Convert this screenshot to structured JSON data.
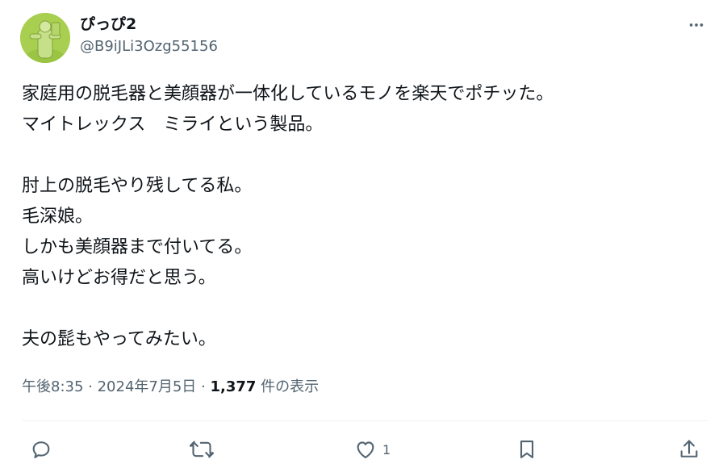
{
  "user": {
    "display_name": "ぴっぴ2",
    "handle": "@B9iJLi3Ozg55156"
  },
  "more_menu_icon": "more-horizontal-icon",
  "body_lines": [
    "家庭用の脱毛器と美顔器が一体化しているモノを楽天でポチッた。",
    "マイトレックス　ミライという製品。",
    "",
    "肘上の脱毛やり残してる私。",
    "毛深娘。",
    "しかも美顔器まで付いてる。",
    "高いけどお得だと思う。",
    "",
    "夫の髭もやってみたい。"
  ],
  "meta": {
    "time": "午後8:35",
    "separator": " · ",
    "date": "2024年7月5日",
    "views_count": "1,377",
    "views_label": " 件の表示"
  },
  "actions": {
    "reply_icon": "reply-icon",
    "retweet_icon": "retweet-icon",
    "like_icon": "heart-icon",
    "like_count": "1",
    "bookmark_icon": "bookmark-icon",
    "share_icon": "share-icon"
  },
  "colors": {
    "text": "#0f1419",
    "secondary": "#536471",
    "divider": "#eff3f4",
    "avatar_bg": "#a8cf4f"
  }
}
